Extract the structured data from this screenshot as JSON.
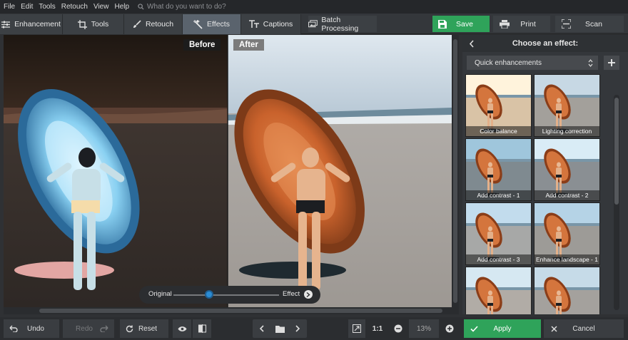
{
  "menu": [
    "File",
    "Edit",
    "Tools",
    "Retouch",
    "View",
    "Help"
  ],
  "search_placeholder": "What do you want to do?",
  "tabs": [
    {
      "label": "Enhancement",
      "icon": "sliders-icon"
    },
    {
      "label": "Tools",
      "icon": "crop-icon"
    },
    {
      "label": "Retouch",
      "icon": "brush-icon"
    },
    {
      "label": "Effects",
      "icon": "magic-wand-icon",
      "active": true
    },
    {
      "label": "Captions",
      "icon": "text-icon"
    }
  ],
  "batch_label": "Batch Processing",
  "save_label": "Save",
  "print_label": "Print",
  "scan_label": "Scan",
  "before_label": "Before",
  "after_label": "After",
  "slider": {
    "left": "Original",
    "right": "Effect",
    "value": 0.34
  },
  "panel": {
    "title": "Choose an effect:",
    "dropdown_value": "Quick enhancements",
    "thumbnails": [
      "Color balance",
      "Lighting correction",
      "Add contrast - 1",
      "Add contrast - 2",
      "Add contrast - 3",
      "Enhance landscape - 1"
    ]
  },
  "bottom": {
    "undo": "Undo",
    "redo": "Redo",
    "reset": "Reset",
    "ratio": "1:1",
    "zoom": "13%",
    "apply": "Apply",
    "cancel": "Cancel"
  },
  "colors": {
    "accent_green": "#2fa35a",
    "active_tab": "#5a636d"
  }
}
